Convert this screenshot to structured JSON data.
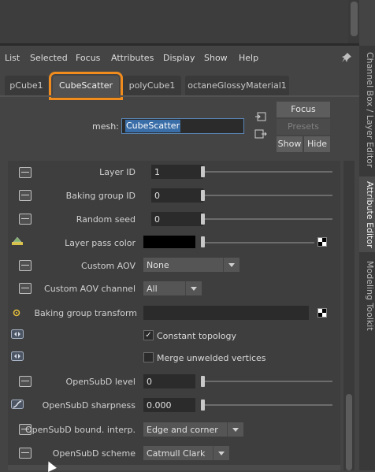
{
  "menu": [
    "List",
    "Selected",
    "Focus",
    "Attributes",
    "Display",
    "Show",
    "Help"
  ],
  "tabs": [
    "pCube1",
    "CubeScatter",
    "polyCube1",
    "octaneGlossyMaterial1"
  ],
  "mesh": {
    "label": "mesh:",
    "value": "CubeScatter"
  },
  "buttons": {
    "focus": "Focus",
    "presets": "Presets",
    "show": "Show",
    "hide": "Hide"
  },
  "side_tabs": [
    "Channel Box / Layer Editor",
    "Attribute Editor",
    "Modeling Toolkit"
  ],
  "attributes": {
    "layer_id": {
      "label": "Layer ID",
      "value": "1"
    },
    "baking_group_id": {
      "label": "Baking group ID",
      "value": "0"
    },
    "random_seed": {
      "label": "Random seed",
      "value": "0"
    },
    "layer_pass_color": {
      "label": "Layer pass color",
      "value": "#000000"
    },
    "custom_aov": {
      "label": "Custom AOV",
      "value": "None"
    },
    "custom_aov_channel": {
      "label": "Custom AOV channel",
      "value": "All"
    },
    "baking_group_transform": {
      "label": "Baking group transform"
    },
    "constant_topology": {
      "label": "Constant topology",
      "checked": true
    },
    "merge_unwelded": {
      "label": "Merge unwelded vertices",
      "checked": false
    },
    "opensubd_level": {
      "label": "OpenSubD level",
      "value": "0"
    },
    "opensubd_sharpness": {
      "label": "OpenSubD sharpness",
      "value": "0.000"
    },
    "opensubd_bound": {
      "label": "OpenSubD bound. interp.",
      "value": "Edge and corner"
    },
    "opensubd_scheme": {
      "label": "OpenSubD scheme",
      "value": "Catmull Clark"
    }
  },
  "colors": {
    "highlight": "#f08c1e",
    "selection": "#3a6ea8"
  }
}
